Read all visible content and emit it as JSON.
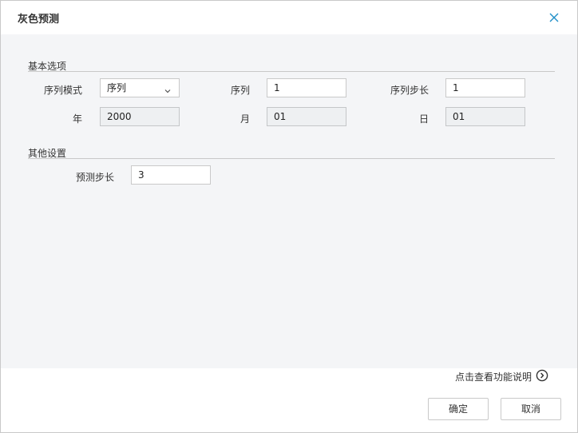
{
  "dialog": {
    "title": "灰色预测",
    "close_icon": "close-icon"
  },
  "basic": {
    "section_title": "基本选项",
    "series_mode_label": "序列模式",
    "series_mode_value": "序列",
    "series_label": "序列",
    "series_value": "1",
    "series_step_label": "序列步长",
    "series_step_value": "1",
    "year_label": "年",
    "year_value": "2000",
    "month_label": "月",
    "month_value": "01",
    "day_label": "日",
    "day_value": "01"
  },
  "other": {
    "section_title": "其他设置",
    "forecast_step_label": "预测步长",
    "forecast_step_value": "3"
  },
  "footer": {
    "help_text": "点击查看功能说明",
    "help_icon": "chevron-right-circle-icon",
    "ok_label": "确定",
    "cancel_label": "取消"
  },
  "colors": {
    "accent": "#1f8fc7",
    "panel_bg": "#f4f5f7"
  }
}
